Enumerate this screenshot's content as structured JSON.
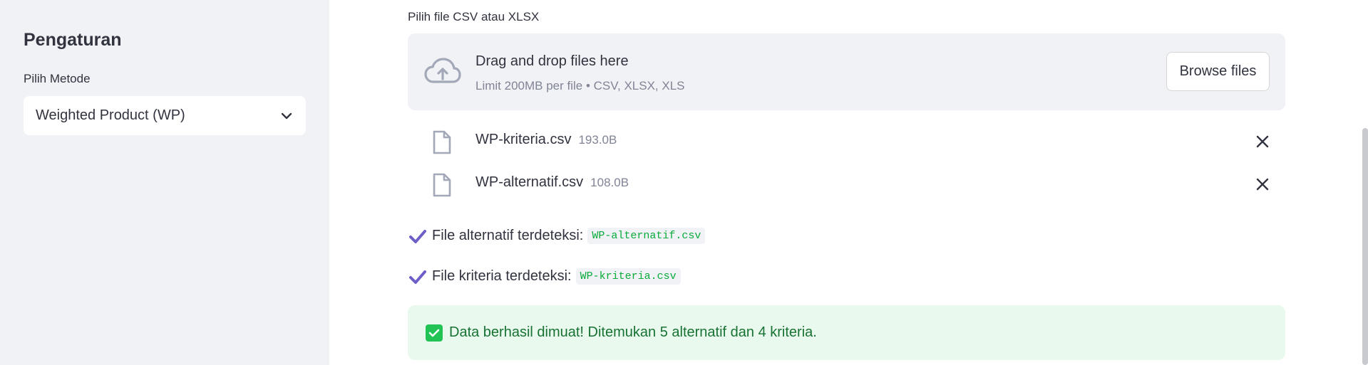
{
  "sidebar": {
    "title": "Pengaturan",
    "method_label": "Pilih Metode",
    "method_value": "Weighted Product (WP)"
  },
  "uploader": {
    "label": "Pilih file CSV atau XLSX",
    "drop_title": "Drag and drop files here",
    "drop_subtitle": "Limit 200MB per file • CSV, XLSX, XLS",
    "browse_label": "Browse files",
    "files": [
      {
        "name": "WP-kriteria.csv",
        "size": "193.0B"
      },
      {
        "name": "WP-alternatif.csv",
        "size": "108.0B"
      }
    ]
  },
  "detections": [
    {
      "text": "File alternatif terdeteksi:",
      "file": "WP-alternatif.csv"
    },
    {
      "text": "File kriteria terdeteksi:",
      "file": "WP-kriteria.csv"
    }
  ],
  "success": {
    "message": "Data berhasil dimuat! Ditemukan 5 alternatif dan 4 kriteria."
  },
  "icons": {
    "upload": "cloud-upload-icon",
    "file": "file-icon",
    "remove": "close-icon",
    "check": "check-icon",
    "success": "check-box-icon",
    "dropdown": "chevron-down-icon"
  },
  "colors": {
    "sidebar_bg": "#f0f2f6",
    "success_bg": "#e9f9ee",
    "success_text": "#177233",
    "check": "#6c5fc7",
    "code_text": "#09ab3b"
  }
}
